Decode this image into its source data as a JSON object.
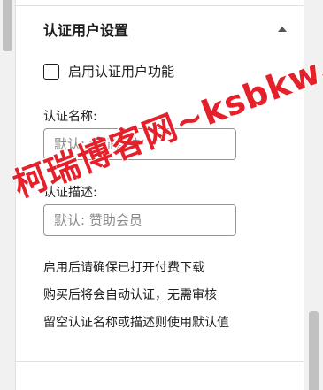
{
  "panel": {
    "title": "认证用户设置",
    "collapse_icon": "triangle-up-icon",
    "enable_checkbox": {
      "label": "启用认证用户功能",
      "checked": false
    },
    "name_field": {
      "label": "认证名称:",
      "placeholder": "默认: 认证用户",
      "value": ""
    },
    "desc_field": {
      "label": "认证描述:",
      "placeholder": "默认: 赞助会员",
      "value": ""
    },
    "help_lines": [
      "启用后请确保已打开付费下载",
      "购买后将会自动认证，无需审核",
      "留空认证名称或描述则使用默认值"
    ]
  },
  "watermark": {
    "text": "柯瑞博客网~ksbkw.com",
    "color": "#e4202a"
  }
}
